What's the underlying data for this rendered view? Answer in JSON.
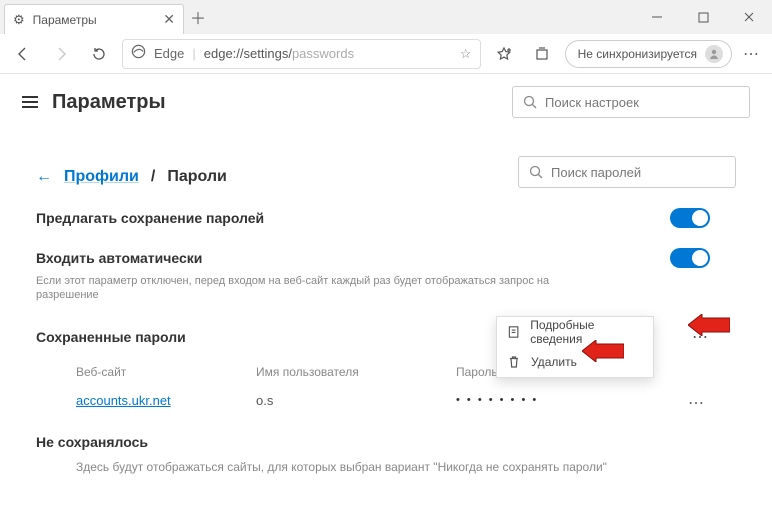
{
  "window": {
    "tab_title": "Параметры"
  },
  "addressbar": {
    "scheme": "Edge",
    "url_part1": "edge://settings/",
    "url_part2": "passwords"
  },
  "sync": {
    "label": "Не синхронизируется"
  },
  "page": {
    "title": "Параметры",
    "search_placeholder": "Поиск настроек"
  },
  "breadcrumb": {
    "parent": "Профили",
    "sep": "/",
    "current": "Пароли",
    "search2_placeholder": "Поиск паролей"
  },
  "opt_save": {
    "label": "Предлагать сохранение паролей"
  },
  "opt_auto": {
    "label": "Входить автоматически",
    "desc": "Если этот параметр отключен, перед входом на веб-сайт каждый раз будет отображаться запрос на разрешение"
  },
  "saved": {
    "header": "Сохраненные пароли"
  },
  "thead": {
    "site": "Веб-сайт",
    "user": "Имя пользователя",
    "pass": "Пароль"
  },
  "row0": {
    "site": "accounts.ukr.net",
    "user": "o.s",
    "pass": "• • • • • • • •"
  },
  "never": {
    "header": "Не сохранялось",
    "desc": "Здесь будут отображаться сайты, для которых выбран вариант \"Никогда не сохранять пароли\""
  },
  "ctx": {
    "details": "Подробные сведения",
    "delete": "Удалить"
  }
}
